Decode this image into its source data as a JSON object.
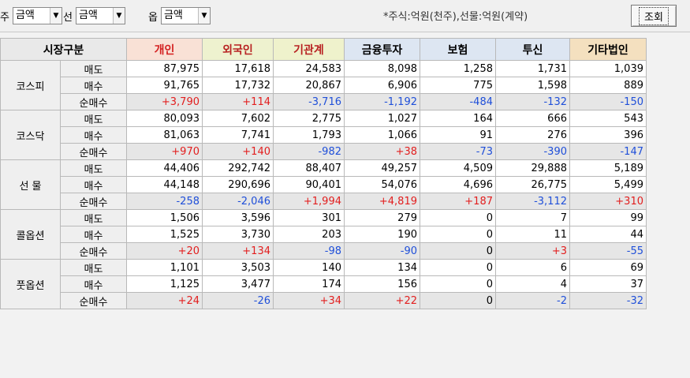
{
  "toolbar": {
    "filter1_label": "주",
    "filter1_value": "금액",
    "filter2_label": "선",
    "filter2_value": "금액",
    "filter3_label": "옵",
    "filter3_value": "금액",
    "unit_note": "*주식:억원(천주),선물:억원(계약)",
    "query_button": "조회"
  },
  "table": {
    "headers": [
      "시장구분",
      "개인",
      "외국인",
      "기관계",
      "금융투자",
      "보험",
      "투신",
      "기타법인"
    ],
    "rows": [
      {
        "market": "코스피",
        "kind": "매도",
        "values": [
          "87,975",
          "17,618",
          "24,583",
          "8,098",
          "1,258",
          "1,731",
          "1,039"
        ]
      },
      {
        "market": "",
        "kind": "매수",
        "values": [
          "91,765",
          "17,732",
          "20,867",
          "6,906",
          "775",
          "1,598",
          "889"
        ]
      },
      {
        "market": "",
        "kind": "순매수",
        "values": [
          "+3,790",
          "+114",
          "-3,716",
          "-1,192",
          "-484",
          "-132",
          "-150"
        ]
      },
      {
        "market": "코스닥",
        "kind": "매도",
        "values": [
          "80,093",
          "7,602",
          "2,775",
          "1,027",
          "164",
          "666",
          "543"
        ]
      },
      {
        "market": "",
        "kind": "매수",
        "values": [
          "81,063",
          "7,741",
          "1,793",
          "1,066",
          "91",
          "276",
          "396"
        ]
      },
      {
        "market": "",
        "kind": "순매수",
        "values": [
          "+970",
          "+140",
          "-982",
          "+38",
          "-73",
          "-390",
          "-147"
        ]
      },
      {
        "market": "선  물",
        "kind": "매도",
        "values": [
          "44,406",
          "292,742",
          "88,407",
          "49,257",
          "4,509",
          "29,888",
          "5,189"
        ]
      },
      {
        "market": "",
        "kind": "매수",
        "values": [
          "44,148",
          "290,696",
          "90,401",
          "54,076",
          "4,696",
          "26,775",
          "5,499"
        ]
      },
      {
        "market": "",
        "kind": "순매수",
        "values": [
          "-258",
          "-2,046",
          "+1,994",
          "+4,819",
          "+187",
          "-3,112",
          "+310"
        ]
      },
      {
        "market": "콜옵션",
        "kind": "매도",
        "values": [
          "1,506",
          "3,596",
          "301",
          "279",
          "0",
          "7",
          "99"
        ]
      },
      {
        "market": "",
        "kind": "매수",
        "values": [
          "1,525",
          "3,730",
          "203",
          "190",
          "0",
          "11",
          "44"
        ]
      },
      {
        "market": "",
        "kind": "순매수",
        "values": [
          "+20",
          "+134",
          "-98",
          "-90",
          "0",
          "+3",
          "-55"
        ]
      },
      {
        "market": "풋옵션",
        "kind": "매도",
        "values": [
          "1,101",
          "3,503",
          "140",
          "134",
          "0",
          "6",
          "69"
        ]
      },
      {
        "market": "",
        "kind": "매수",
        "values": [
          "1,125",
          "3,477",
          "174",
          "156",
          "0",
          "4",
          "37"
        ]
      },
      {
        "market": "",
        "kind": "순매수",
        "values": [
          "+24",
          "-26",
          "+34",
          "+22",
          "0",
          "-2",
          "-32"
        ]
      }
    ]
  },
  "colors": {
    "positive": "#e21e1e",
    "negative": "#1f4fd9"
  }
}
